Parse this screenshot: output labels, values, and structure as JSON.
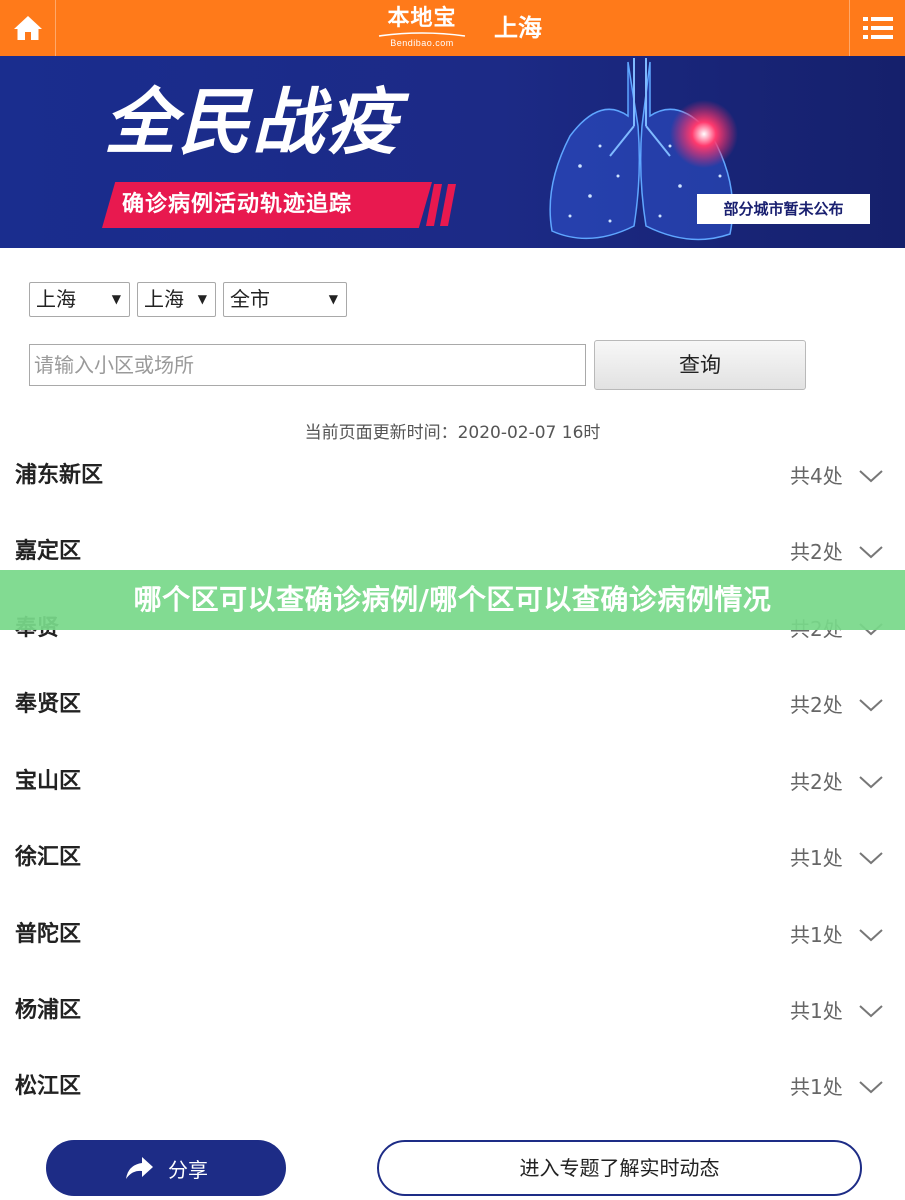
{
  "header": {
    "brand_logo": "本地宝",
    "brand_sub": "Bendibao.com",
    "city": "上海",
    "colors": {
      "bar": "#ff7a1a"
    },
    "home_icon": "home-icon",
    "menu_icon": "menu-icon"
  },
  "banner": {
    "title": "全民战疫",
    "tag": "确诊病例活动轨迹追踪",
    "note": "部分城市暂未公布"
  },
  "filters": {
    "province": "上海",
    "city": "上海",
    "district": "全市",
    "search_placeholder": "请输入小区或场所",
    "search_button": "查询"
  },
  "update_time": "当前页面更新时间：2020-02-07 16时",
  "districts": [
    {
      "name": "浦东新区",
      "count": "共4处"
    },
    {
      "name": "嘉定区",
      "count": "共2处"
    },
    {
      "name": "奉贤",
      "count": "共2处"
    },
    {
      "name": "奉贤区",
      "count": "共2处"
    },
    {
      "name": "宝山区",
      "count": "共2处"
    },
    {
      "name": "徐汇区",
      "count": "共1处"
    },
    {
      "name": "普陀区",
      "count": "共1处"
    },
    {
      "name": "杨浦区",
      "count": "共1处"
    },
    {
      "name": "松江区",
      "count": "共1处"
    }
  ],
  "overlay_title": "哪个区可以查确诊病例/哪个区可以查确诊病例情况",
  "footer": {
    "share_label": "分享",
    "topic_label": "进入专题了解实时动态"
  }
}
